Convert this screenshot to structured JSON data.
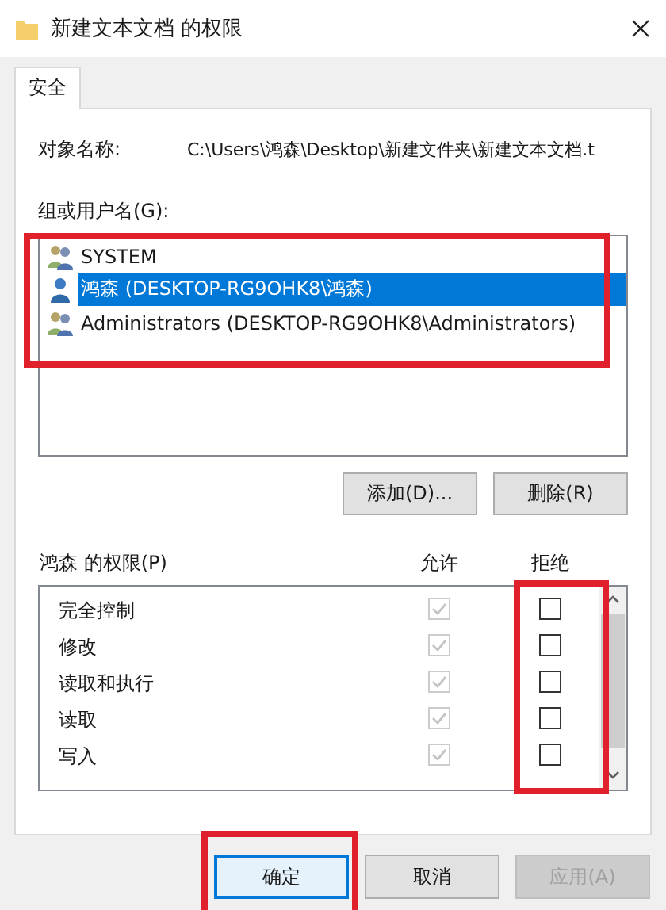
{
  "window": {
    "title": "新建文本文档 的权限"
  },
  "tabs": [
    {
      "label": "安全",
      "selected": true
    }
  ],
  "object_name": {
    "label": "对象名称:",
    "value": "C:\\Users\\鸿森\\Desktop\\新建文件夹\\新建文本文档.t"
  },
  "users": {
    "label": "组或用户名(G):",
    "highlighted": true,
    "items": [
      {
        "name": "SYSTEM",
        "kind": "group",
        "selected": false
      },
      {
        "name": "鸿森 (DESKTOP-RG9OHK8\\鸿森)",
        "kind": "user",
        "selected": true
      },
      {
        "name": "Administrators (DESKTOP-RG9OHK8\\Administrators)",
        "kind": "group",
        "selected": false
      }
    ]
  },
  "user_buttons": [
    "添加(D)...",
    "删除(R)"
  ],
  "permissions": {
    "title": "鸿森 的权限(P)",
    "columns": [
      "允许",
      "拒绝"
    ],
    "deny_highlighted": true,
    "rows": [
      {
        "name": "完全控制",
        "allow_checked": true,
        "allow_disabled": true,
        "deny_checked": false
      },
      {
        "name": "修改",
        "allow_checked": true,
        "allow_disabled": true,
        "deny_checked": false
      },
      {
        "name": "读取和执行",
        "allow_checked": true,
        "allow_disabled": true,
        "deny_checked": false
      },
      {
        "name": "读取",
        "allow_checked": true,
        "allow_disabled": true,
        "deny_checked": false
      },
      {
        "name": "写入",
        "allow_checked": true,
        "allow_disabled": true,
        "deny_checked": false
      }
    ]
  },
  "footer_buttons": [
    {
      "label": "确定",
      "kind": "default",
      "disabled": false,
      "highlighted": true
    },
    {
      "label": "取消",
      "kind": "normal",
      "disabled": false,
      "highlighted": false
    },
    {
      "label": "应用(A)",
      "kind": "normal",
      "disabled": true,
      "highlighted": false
    }
  ]
}
